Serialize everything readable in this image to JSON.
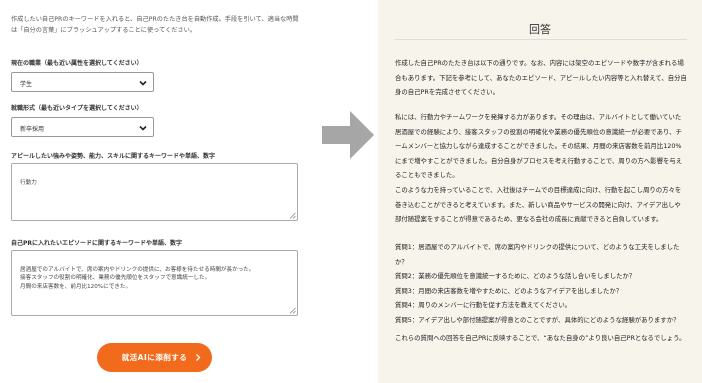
{
  "form": {
    "intro": "作成したい自己PRのキーワードを入れると、自己PRのたたき台を自動作成。手段を引いて、適当な時間は「自分の言葉」にブラッシュアップすることに使ってください。",
    "status": {
      "label": "現在の職業（最も近い属性を選択してください）",
      "value": "学生"
    },
    "employment": {
      "label": "就職形式（最も近いタイプを選択してください）",
      "value": "新卒採用"
    },
    "keywords": {
      "label": "アピールしたい強みや姿勢、能力、スキルに関するキーワードや単語、数字",
      "value": "行動力"
    },
    "episode": {
      "label": "自己PRに入れたいエピソードに関するキーワードや単語、数字",
      "value": "居酒屋でのアルバイトで、席の案内やドリンクの提供に、お客様を待たせる時間が長かった。\n接客スタッフの役割の明確化、業務の優先順位をスタッフで意識統一した。\n月間の来店客数を、前月比120%にできた。"
    },
    "submit_label": "就活AIに添削する",
    "submit_arrow": "›"
  },
  "answer": {
    "title": "回答",
    "paragraphs": [
      "作成した自己PRのたたき台は以下の通りです。なお、内容には架空のエピソードや数字が含まれる場合もあります。下記を参考にして、あなたのエピソード、アピールしたい内容等と入れ替えて、自分自身の自己PRを完成させてください。",
      "私には、行動力やチームワークを発揮する力があります。その理由は、アルバイトとして働いていた居酒屋での経験により、接客スタッフの役割の明確化や業務の優先順位の意識統一が必要であり、チームメンバーと協力しながら達成することができました。その結果、月間の来店客数を前月比120%にまで増やすことができました。自分自身がプロセスを考え行動することで、周りの方へ影響を与えることもできました。",
      "このような力を持っていることで、入社後はチームでの目標達成に向け、行動を起こし周りの方々を巻き込むことができると考えています。また、新しい商品やサービスの開発に向け、アイデア出しや部付随提案をすることが得意であるため、更なる会社の成長に貢献できると自負しています。",
      "質問1：居酒屋でのアルバイトで、席の案内やドリンクの提供について、どのような工夫をしましたか？\n質問2：業務の優先順位を意識統一するために、どのような話し合いをしましたか？\n質問3：月間の来店客数を増やすために、どのようなアイデアを出しましたか？\n質問4：周りのメンバーに行動を促す方法を教えてください。\n質問5：アイデア出しや部付随提案が得意とのことですが、具体的にどのような経験がありますか？",
      "これらの質問への回答を自己PRに反映することで、“あなた自身の”より良い自己PRとなるでしょう。"
    ]
  },
  "colors": {
    "accent": "#f26b1d",
    "arrow": "#a6a6a6",
    "answer_bg": "#f7f4ec"
  },
  "icons": [
    "chevron-down-icon",
    "resize-handle-icon",
    "arrow-right-icon"
  ]
}
